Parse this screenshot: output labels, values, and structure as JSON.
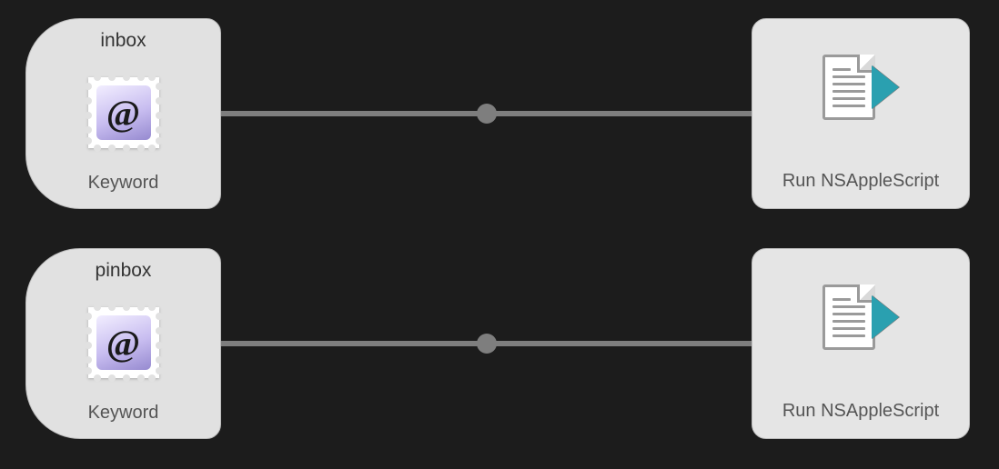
{
  "nodes": {
    "trigger1": {
      "title": "inbox",
      "subtitle": "Keyword",
      "icon": "mail-stamp-icon",
      "at_glyph": "@"
    },
    "trigger2": {
      "title": "pinbox",
      "subtitle": "Keyword",
      "icon": "mail-stamp-icon",
      "at_glyph": "@"
    },
    "action1": {
      "label": "Run NSAppleScript",
      "icon": "applescript-run-icon"
    },
    "action2": {
      "label": "Run NSAppleScript",
      "icon": "applescript-run-icon"
    }
  },
  "colors": {
    "canvas_bg": "#1c1c1c",
    "node_bg": "#e3e3e3",
    "node_border": "#bcbcbc",
    "connection": "#7e7e7e",
    "script_accent": "#2aa0b0",
    "stamp_gradient_start": "#f2eeff",
    "stamp_gradient_end": "#968ad0"
  }
}
